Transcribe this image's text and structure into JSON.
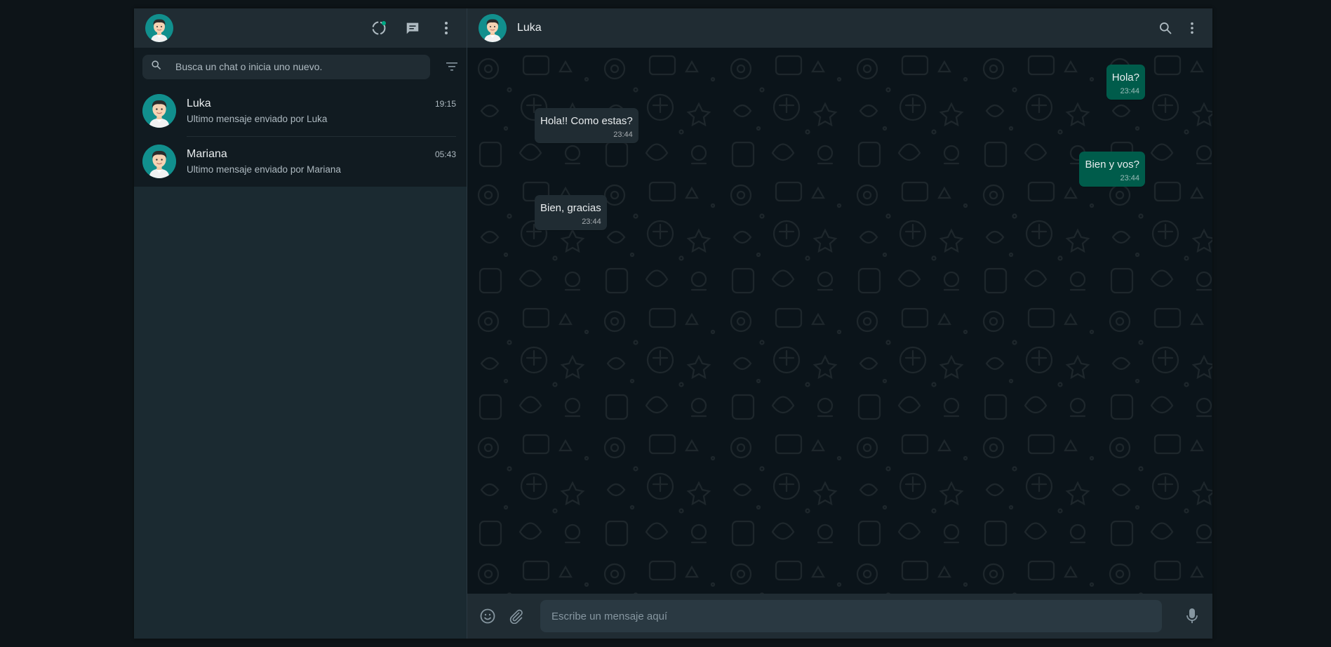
{
  "sidebar": {
    "search": {
      "placeholder": "Busca un chat o inicia uno nuevo.",
      "value": ""
    },
    "chats": [
      {
        "name": "Luka",
        "time": "19:15",
        "last_message": "Ultimo mensaje enviado por Luka"
      },
      {
        "name": "Mariana",
        "time": "05:43",
        "last_message": "Ultimo mensaje enviado por Mariana"
      }
    ]
  },
  "conversation": {
    "contact_name": "Luka",
    "messages": [
      {
        "direction": "out",
        "text": "Hola?",
        "time": "23:44"
      },
      {
        "direction": "in",
        "text": "Hola!! Como estas?",
        "time": "23:44"
      },
      {
        "direction": "out",
        "text": "Bien y vos?",
        "time": "23:44"
      },
      {
        "direction": "in",
        "text": "Bien, gracias",
        "time": "23:44"
      }
    ],
    "composer": {
      "placeholder": "Escribe un mensaje aquí",
      "value": ""
    }
  },
  "icons": {
    "status": "status-icon",
    "new_chat": "new-chat-icon",
    "menu": "menu-dots-icon",
    "search": "search-icon",
    "filter": "filter-icon",
    "emoji": "emoji-icon",
    "attach": "paperclip-icon",
    "mic": "microphone-icon"
  },
  "colors": {
    "outgoing_bubble": "#005c4b",
    "incoming_bubble": "#202c33",
    "header": "#202c33",
    "accent": "#00a884"
  }
}
